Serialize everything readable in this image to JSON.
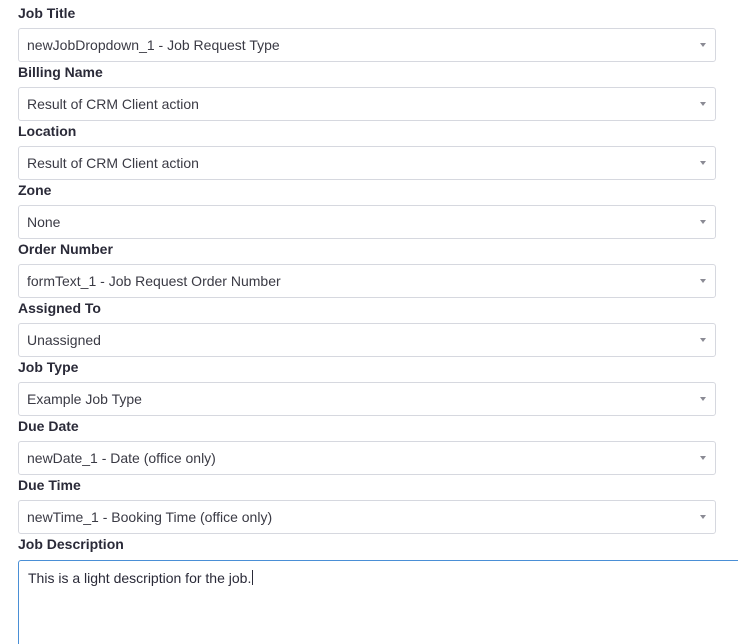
{
  "form": {
    "fields": [
      {
        "label": "Job Title",
        "value": "newJobDropdown_1 - Job Request Type"
      },
      {
        "label": "Billing Name",
        "value": "Result of CRM Client action"
      },
      {
        "label": "Location",
        "value": "Result of CRM Client action"
      },
      {
        "label": "Zone",
        "value": "None"
      },
      {
        "label": "Order Number",
        "value": "formText_1 - Job Request Order Number"
      },
      {
        "label": "Assigned To",
        "value": "Unassigned"
      },
      {
        "label": "Job Type",
        "value": "Example Job Type"
      },
      {
        "label": "Due Date",
        "value": "newDate_1 - Date (office only)"
      },
      {
        "label": "Due Time",
        "value": "newTime_1 - Booking Time (office only)"
      }
    ],
    "description": {
      "label": "Job Description",
      "value": "This is a light description for the job."
    }
  },
  "colors": {
    "label_text": "#2a2a38",
    "field_border": "#d6d8df",
    "focus_border": "#4a8fd6"
  }
}
